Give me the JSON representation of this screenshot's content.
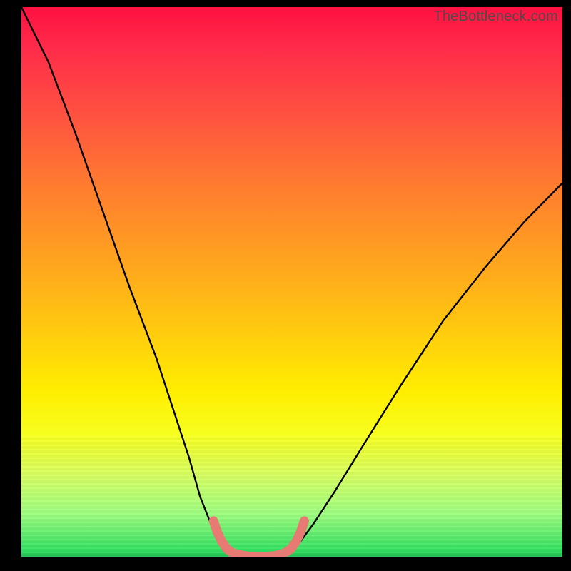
{
  "watermark": "TheBottleneck.com",
  "colors": {
    "frame": "#000000",
    "gradient_top": "#ff1040",
    "gradient_mid": "#ffee00",
    "gradient_bottom": "#20c050",
    "curve_stroke": "#000000",
    "trough_stroke": "#e77a72"
  },
  "chart_data": {
    "type": "line",
    "title": "",
    "xlabel": "",
    "ylabel": "",
    "xlim": [
      0,
      100
    ],
    "ylim": [
      0,
      100
    ],
    "curve": [
      {
        "x": 0,
        "y": 100
      },
      {
        "x": 5,
        "y": 90
      },
      {
        "x": 10,
        "y": 77
      },
      {
        "x": 15,
        "y": 63
      },
      {
        "x": 20,
        "y": 49
      },
      {
        "x": 25,
        "y": 36
      },
      {
        "x": 28,
        "y": 27
      },
      {
        "x": 31,
        "y": 18
      },
      {
        "x": 33,
        "y": 11
      },
      {
        "x": 35,
        "y": 6
      },
      {
        "x": 37,
        "y": 2
      },
      {
        "x": 39,
        "y": 0.5
      },
      {
        "x": 42,
        "y": 0
      },
      {
        "x": 46,
        "y": 0
      },
      {
        "x": 49,
        "y": 0.5
      },
      {
        "x": 51,
        "y": 2
      },
      {
        "x": 54,
        "y": 6
      },
      {
        "x": 58,
        "y": 12
      },
      {
        "x": 63,
        "y": 20
      },
      {
        "x": 70,
        "y": 31
      },
      {
        "x": 78,
        "y": 43
      },
      {
        "x": 86,
        "y": 53
      },
      {
        "x": 93,
        "y": 61
      },
      {
        "x": 100,
        "y": 68
      }
    ],
    "trough_highlight": [
      {
        "x": 35.5,
        "y": 6.5
      },
      {
        "x": 36.2,
        "y": 4.5
      },
      {
        "x": 37.0,
        "y": 2.8
      },
      {
        "x": 38.0,
        "y": 1.4
      },
      {
        "x": 39.2,
        "y": 0.6
      },
      {
        "x": 41.0,
        "y": 0.2
      },
      {
        "x": 43.0,
        "y": 0.0
      },
      {
        "x": 45.0,
        "y": 0.0
      },
      {
        "x": 47.0,
        "y": 0.2
      },
      {
        "x": 48.5,
        "y": 0.6
      },
      {
        "x": 49.8,
        "y": 1.4
      },
      {
        "x": 50.8,
        "y": 2.8
      },
      {
        "x": 51.6,
        "y": 4.5
      },
      {
        "x": 52.3,
        "y": 6.5
      }
    ],
    "annotations": []
  }
}
